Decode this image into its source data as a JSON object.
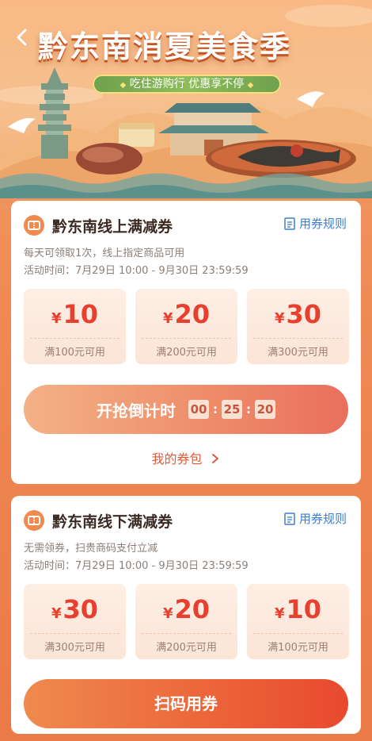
{
  "header": {
    "back_icon": "chevron-left-icon",
    "title": "黔东南消夏美食季",
    "subtitle": "吃住游购行 优惠享不停"
  },
  "online": {
    "title": "黔东南线上满减券",
    "rules_label": "用券规则",
    "desc_line1": "每天可领取1次，线上指定商品可用",
    "desc_line2": "活动时间：7月29日 10:00 - 9月30日 23:59:59",
    "coupons": [
      {
        "currency": "¥",
        "amount": "10",
        "condition": "满100元可用"
      },
      {
        "currency": "¥",
        "amount": "20",
        "condition": "满200元可用"
      },
      {
        "currency": "¥",
        "amount": "30",
        "condition": "满300元可用"
      }
    ],
    "grab_label": "开抢倒计时",
    "countdown": {
      "hours": "00",
      "minutes": "25",
      "seconds": "20"
    },
    "wallet_label": "我的券包"
  },
  "offline": {
    "title": "黔东南线下满减券",
    "rules_label": "用券规则",
    "desc_line1": "无需领券，扫贵商码支付立减",
    "desc_line2": "活动时间：7月29日 10:00 - 9月30日 23:59:59",
    "coupons": [
      {
        "currency": "¥",
        "amount": "30",
        "condition": "满300元可用"
      },
      {
        "currency": "¥",
        "amount": "20",
        "condition": "满200元可用"
      },
      {
        "currency": "¥",
        "amount": "10",
        "condition": "满100元可用"
      }
    ],
    "scan_label": "扫码用券"
  },
  "colors": {
    "accent_red": "#e8402f",
    "link_blue": "#3b7fd0",
    "brand_orange": "#f08a4e"
  }
}
